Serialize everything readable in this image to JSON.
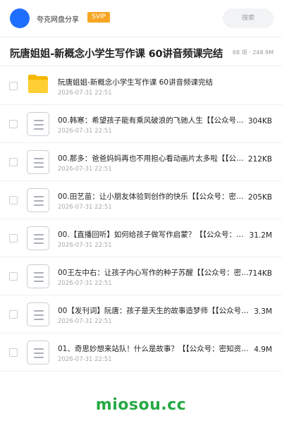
{
  "header": {
    "brand": "夸克网盘分享",
    "badge": "SVIP",
    "search_placeholder": "搜索",
    "colors": {
      "avatar": "#1f6fff",
      "badge": "#f6a623"
    }
  },
  "page": {
    "title": "阮唐姐姐-新概念小学生写作课 60讲音频课完结",
    "meta": "68 项 · 248.9M"
  },
  "files": [
    {
      "type": "folder",
      "icon": "folder-icon",
      "name": "阮唐姐姐-新概念小学生写作课 60讲音频课完结",
      "date": "2026-07-31 22:51",
      "size": ""
    },
    {
      "type": "file",
      "icon": "document-icon",
      "name": "00.韩寒：希望孩子能有乘风破浪的飞驰人生【【公众号：密知资源】】",
      "date": "2026-07-31 22:51",
      "size": "304KB"
    },
    {
      "type": "file",
      "icon": "document-icon",
      "name": "00.那多：爸爸妈妈再也不用担心看动画片太多啦【【公众号：密知资源】】",
      "date": "2026-07-31 22:51",
      "size": "212KB"
    },
    {
      "type": "file",
      "icon": "document-icon",
      "name": "00.田艺苗：让小朋友体验到创作的快乐【【公众号：密知资源】】",
      "date": "2026-07-31 22:51",
      "size": "205KB"
    },
    {
      "type": "file",
      "icon": "document-icon",
      "name": "00.【直播回听】如何给孩子做写作启蒙？【【公众号：密知资源】】",
      "date": "2026-07-31 22:51",
      "size": "31.2M"
    },
    {
      "type": "file",
      "icon": "document-icon",
      "name": "00王左中右：让孩子内心写作的种子苏醒【【公众号：密知资源】】",
      "date": "2026-07-31 22:51",
      "size": "714KB"
    },
    {
      "type": "file",
      "icon": "document-icon",
      "name": "00【发刊词】阮唐：孩子是天生的故事造梦师【【公众号：密知资源】】",
      "date": "2026-07-31 22:51",
      "size": "3.3M"
    },
    {
      "type": "file",
      "icon": "document-icon",
      "name": "01、奇思妙想来站队！什么是故事？【【公众号：密知资源】】",
      "date": "2026-07-31 22:51",
      "size": "4.9M"
    }
  ],
  "footer": {
    "watermark": "miosou.cc",
    "color": "#27a844"
  }
}
